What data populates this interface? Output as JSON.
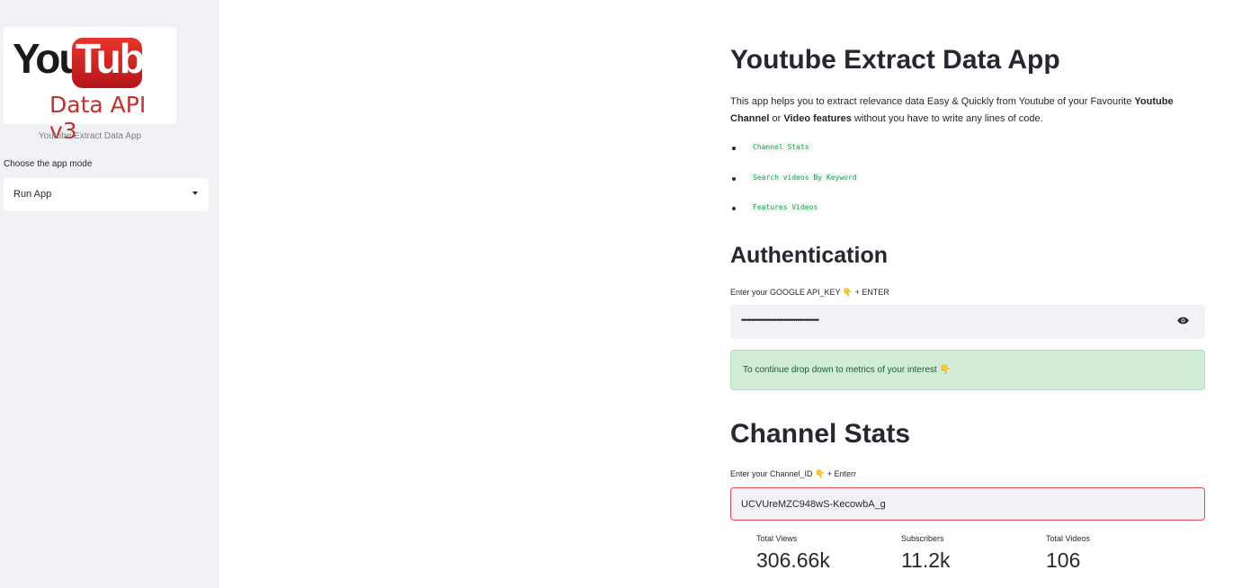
{
  "sidebar": {
    "logo": {
      "word_you": "You",
      "word_tube": "Tube",
      "subtitle": "Data API v3"
    },
    "caption": "Youtube Extract Data App",
    "mode_label": "Choose the app mode",
    "mode_select": {
      "value": "Run App"
    }
  },
  "main": {
    "title": "Youtube Extract Data App",
    "intro": {
      "part1": "This app helps you to extract relevance data Easy & Quickly from Youtube of your Favourite ",
      "bold1": "Youtube Channel",
      "part2": " or ",
      "bold2": "Video features",
      "part3": " without you have to write any lines of code."
    },
    "features": [
      "Channel Stats",
      "Search videos By Keyword",
      "Features Videos"
    ],
    "auth": {
      "heading": "Authentication",
      "label": "Enter your GOOGLE API_KEY 👇 + ENTER",
      "masked_value": "••••••••••••••••••••••••••••••••••••••••"
    },
    "alert_text": "To continue drop down to metrics of your interest 👇",
    "channel": {
      "heading": "Channel Stats",
      "label": "Enter your Channel_ID 👇 + Enterr",
      "value": "UCVUreMZC948wS-KecowbA_g"
    },
    "metrics": [
      {
        "label": "Total Views",
        "value": "306.66k"
      },
      {
        "label": "Subscribers",
        "value": "11.2k"
      },
      {
        "label": "Total Videos",
        "value": "106"
      }
    ]
  },
  "colors": {
    "sidebar_bg": "#f0f2f6",
    "youtube_red": "#c4302b",
    "code_green": "#09ab3b",
    "success_bg": "#d0ecd7",
    "error_border": "#e04b4b"
  }
}
